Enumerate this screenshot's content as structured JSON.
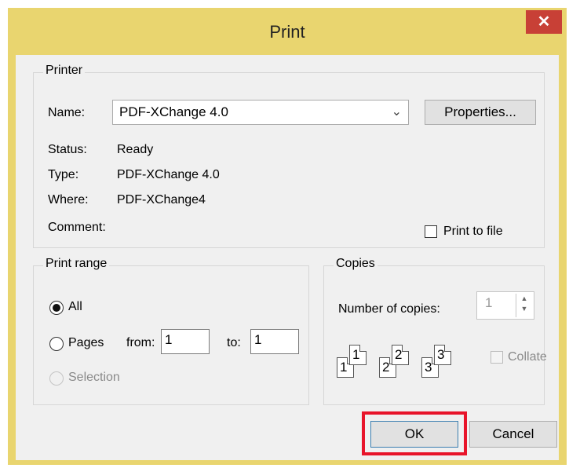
{
  "dialog": {
    "title": "Print",
    "close_glyph": "✕"
  },
  "printer": {
    "group_label": "Printer",
    "name_label": "Name:",
    "name_value": "PDF-XChange 4.0",
    "properties_label": "Properties...",
    "status_label": "Status:",
    "status_value": "Ready",
    "type_label": "Type:",
    "type_value": "PDF-XChange 4.0",
    "where_label": "Where:",
    "where_value": "PDF-XChange4",
    "comment_label": "Comment:",
    "print_to_file_label": "Print to file",
    "print_to_file_checked": false
  },
  "print_range": {
    "group_label": "Print range",
    "all_label": "All",
    "all_selected": true,
    "pages_label": "Pages",
    "from_label": "from:",
    "from_value": "1",
    "to_label": "to:",
    "to_value": "1",
    "selection_label": "Selection"
  },
  "copies": {
    "group_label": "Copies",
    "number_label": "Number of copies:",
    "number_value": "1",
    "collate_label": "Collate",
    "collate_icon_pages": [
      "1",
      "1",
      "2",
      "2",
      "3",
      "3"
    ]
  },
  "buttons": {
    "ok_label": "OK",
    "cancel_label": "Cancel"
  },
  "highlight_color": "#e8142a"
}
